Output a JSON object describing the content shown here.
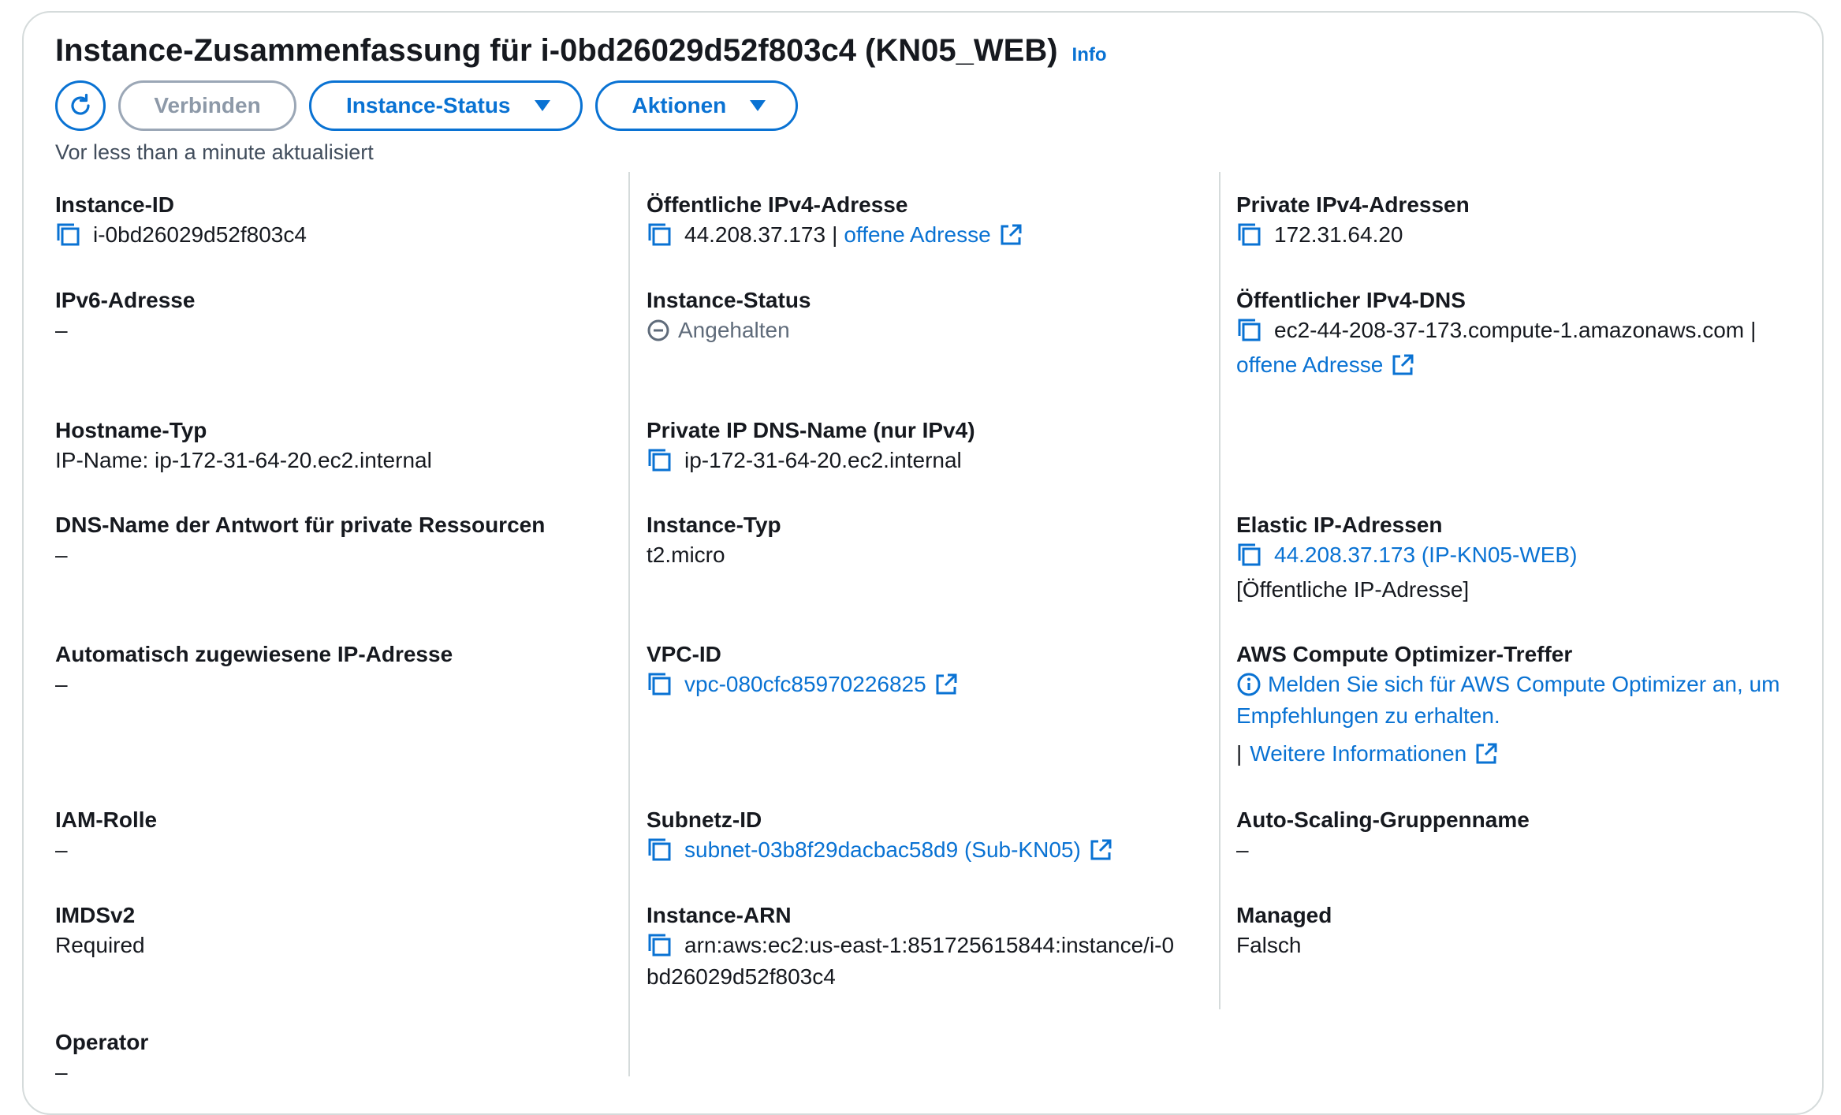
{
  "header": {
    "title": "Instance-Zusammenfassung für i-0bd26029d52f803c4 (KN05_WEB)",
    "info_label": "Info"
  },
  "toolbar": {
    "connect_label": "Verbinden",
    "instance_status_label": "Instance-Status",
    "actions_label": "Aktionen"
  },
  "updated_text": "Vor less than a minute aktualisiert",
  "col1": {
    "instance_id": {
      "label": "Instance-ID",
      "value": "i-0bd26029d52f803c4"
    },
    "ipv6": {
      "label": "IPv6-Adresse",
      "value": "–"
    },
    "hostname_type": {
      "label": "Hostname-Typ",
      "value": "IP-Name: ip-172-31-64-20.ec2.internal"
    },
    "dns_answer": {
      "label": "DNS-Name der Antwort für private Ressourcen",
      "value": "–"
    },
    "auto_ip": {
      "label": "Automatisch zugewiesene IP-Adresse",
      "value": "–"
    },
    "iam_role": {
      "label": "IAM-Rolle",
      "value": "–"
    },
    "imdsv2": {
      "label": "IMDSv2",
      "value": "Required"
    },
    "operator": {
      "label": "Operator",
      "value": "–"
    }
  },
  "col2": {
    "public_ipv4": {
      "label": "Öffentliche IPv4-Adresse",
      "value": "44.208.37.173",
      "sep": "|",
      "link": "offene Adresse"
    },
    "instance_status": {
      "label": "Instance-Status",
      "value": "Angehalten"
    },
    "private_dns": {
      "label": "Private IP DNS-Name (nur IPv4)",
      "value": "ip-172-31-64-20.ec2.internal"
    },
    "instance_type": {
      "label": "Instance-Typ",
      "value": "t2.micro"
    },
    "vpc_id": {
      "label": "VPC-ID",
      "value": "vpc-080cfc85970226825"
    },
    "subnet_id": {
      "label": "Subnetz-ID",
      "value": "subnet-03b8f29dacbac58d9 (Sub-KN05)"
    },
    "instance_arn": {
      "label": "Instance-ARN",
      "value_line1": "arn:aws:ec2:us-east-1:851725615844:instance/i-0",
      "value_line2": "bd26029d52f803c4"
    }
  },
  "col3": {
    "private_ipv4": {
      "label": "Private IPv4-Adressen",
      "value": "172.31.64.20"
    },
    "public_dns": {
      "label": "Öffentlicher IPv4-DNS",
      "value": "ec2-44-208-37-173.compute-1.amazonaws.com",
      "sep": "|",
      "link": "offene Adresse"
    },
    "elastic_ip": {
      "label": "Elastic IP-Adressen",
      "value": "44.208.37.173 (IP-KN05-WEB)",
      "note": "[Öffentliche IP-Adresse]"
    },
    "optimizer": {
      "label": "AWS Compute Optimizer-Treffer",
      "line1": "Melden Sie sich für AWS Compute Optimizer an, um",
      "line2": "Empfehlungen zu erhalten.",
      "sep": "|",
      "more_link": "Weitere Informationen"
    },
    "asg": {
      "label": "Auto-Scaling-Gruppenname",
      "value": "–"
    },
    "managed": {
      "label": "Managed",
      "value": "Falsch"
    }
  },
  "colors": {
    "link": "#0972d3",
    "border": "#d5dbdb",
    "disabled": "#9ba7b6",
    "text": "#16191f"
  }
}
